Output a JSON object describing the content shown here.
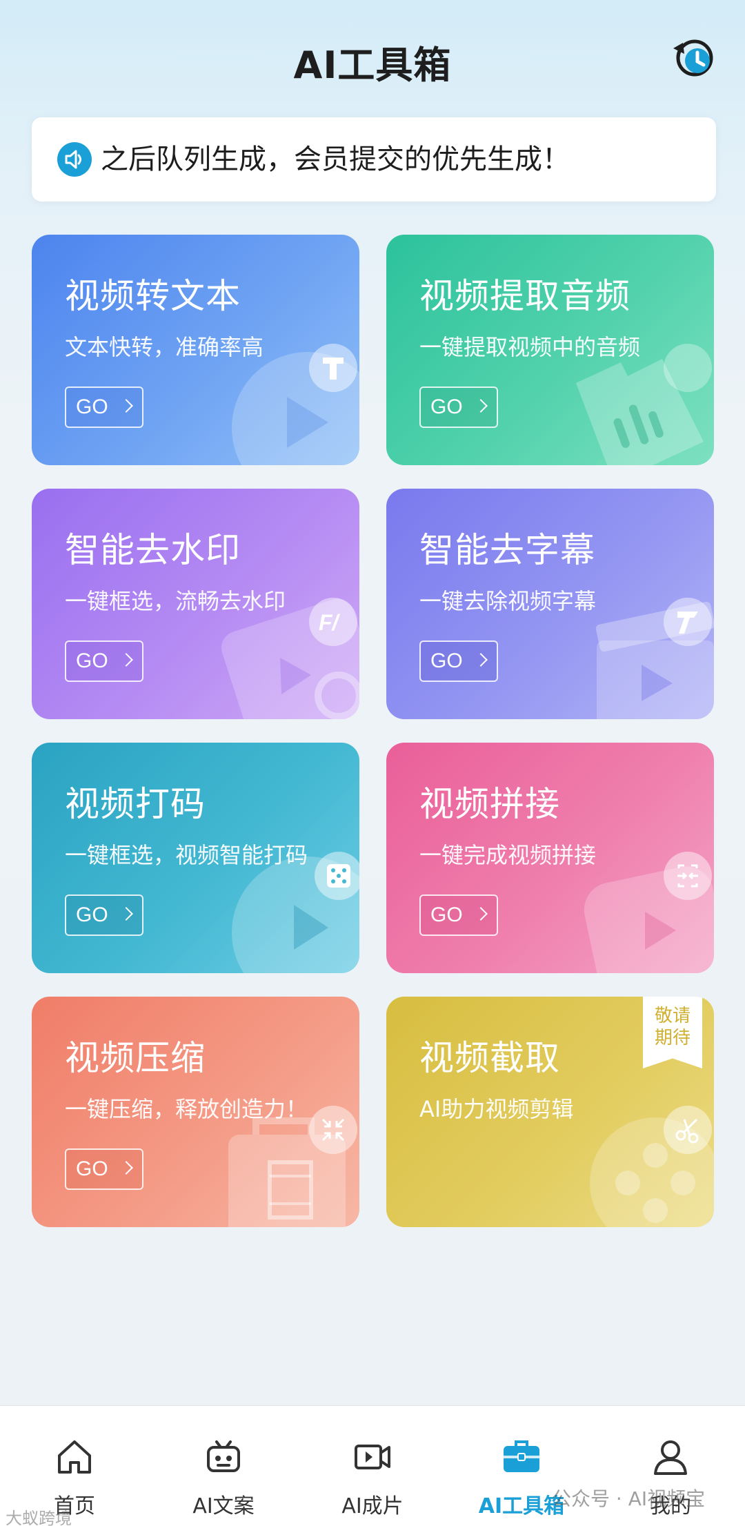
{
  "header": {
    "title": "AI工具箱"
  },
  "notice": {
    "text": "之后队列生成，会员提交的优先生成！"
  },
  "cards": [
    {
      "title": "视频转文本",
      "subtitle": "文本快转，准确率高",
      "go": "GO"
    },
    {
      "title": "视频提取音频",
      "subtitle": "一键提取视频中的音频",
      "go": "GO"
    },
    {
      "title": "智能去水印",
      "subtitle": "一键框选，流畅去水印",
      "go": "GO"
    },
    {
      "title": "智能去字幕",
      "subtitle": "一键去除视频字幕",
      "go": "GO"
    },
    {
      "title": "视频打码",
      "subtitle": "一键框选，视频智能打码",
      "go": "GO"
    },
    {
      "title": "视频拼接",
      "subtitle": "一键完成视频拼接",
      "go": "GO"
    },
    {
      "title": "视频压缩",
      "subtitle": "一键压缩，释放创造力！",
      "go": "GO"
    },
    {
      "title": "视频截取",
      "subtitle": "AI助力视频剪辑",
      "ribbon_line1": "敬请",
      "ribbon_line2": "期待"
    }
  ],
  "tabbar": {
    "items": [
      {
        "label": "首页",
        "icon": "home-icon"
      },
      {
        "label": "AI文案",
        "icon": "robot-icon"
      },
      {
        "label": "AI成片",
        "icon": "video-camera-icon"
      },
      {
        "label": "AI工具箱",
        "icon": "toolbox-icon",
        "active": true
      },
      {
        "label": "我的",
        "icon": "user-icon"
      }
    ]
  },
  "watermarks": {
    "right": "公众号 · AI视频宝",
    "left": "大蚁跨境"
  },
  "colors": {
    "accent": "#1a9fd6"
  }
}
